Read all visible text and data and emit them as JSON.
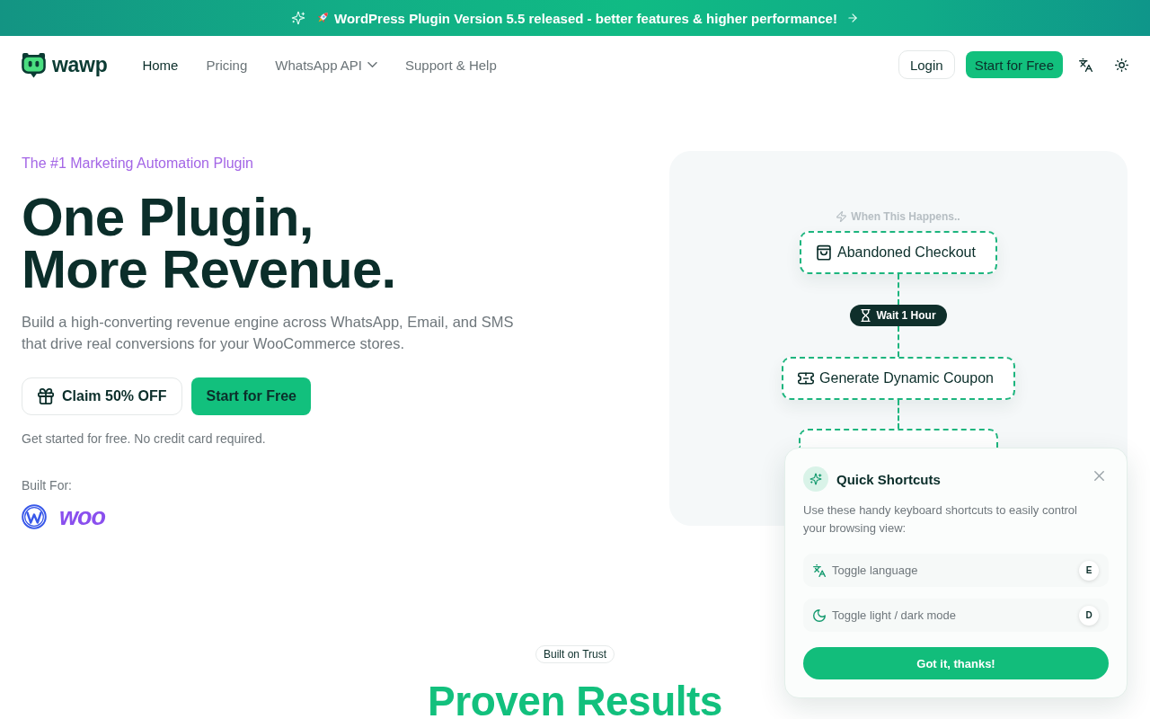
{
  "announcement": {
    "text": "WordPress Plugin Version 5.5 released - better features & higher performance!"
  },
  "header": {
    "logo": "wawp",
    "nav": [
      {
        "label": "Home",
        "selected": true,
        "dropdown": false
      },
      {
        "label": "Pricing",
        "selected": false,
        "dropdown": false
      },
      {
        "label": "WhatsApp API",
        "selected": false,
        "dropdown": true
      },
      {
        "label": "Support & Help",
        "selected": false,
        "dropdown": false
      }
    ],
    "login": "Login",
    "cta": "Start for Free"
  },
  "hero": {
    "eyebrow": "The #1 Marketing Automation Plugin",
    "title_lines": [
      "One Plugin,",
      "More Revenue."
    ],
    "description": "Build a high-converting revenue engine across WhatsApp, Email, and SMS that drive real conversions for your WooCommerce stores.",
    "buttons": [
      {
        "label": "Claim 50% OFF",
        "kind": "outline"
      },
      {
        "label": "Start for Free",
        "kind": "primary"
      }
    ],
    "note": "Get started for free. No credit card required.",
    "built_for": {
      "label": "Built For:",
      "woo_logo": "woo"
    }
  },
  "workflow": {
    "trigger_label": "When This Happens..",
    "steps": [
      {
        "kind": "action",
        "label": "Abandoned Checkout"
      },
      {
        "kind": "delay",
        "label": "Wait 1 Hour"
      },
      {
        "kind": "action",
        "label": "Generate Dynamic Coupon"
      },
      {
        "kind": "covered"
      }
    ]
  },
  "shortcuts_popup": {
    "title": "Quick Shortcuts",
    "description": "Use these handy keyboard shortcuts to easily control your browsing view:",
    "shortcuts": [
      {
        "label": "Toggle language",
        "key": "E"
      },
      {
        "label": "Toggle light / dark mode",
        "key": "D"
      }
    ],
    "button": "Got it, thanks!"
  },
  "trust": {
    "badge": "Built on Trust",
    "heading": "Proven Results"
  }
}
